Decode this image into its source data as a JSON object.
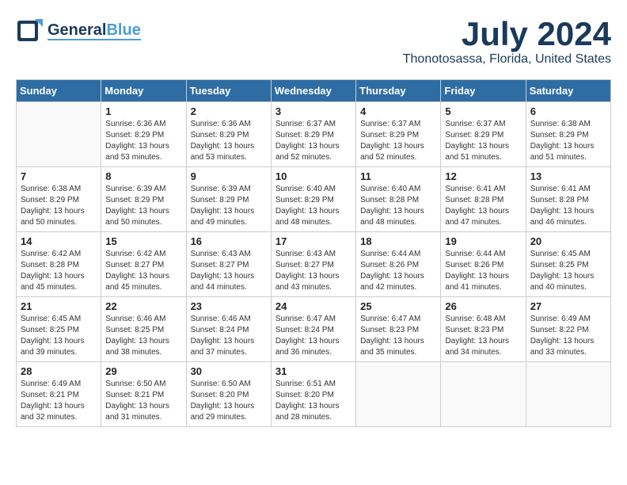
{
  "header": {
    "logo_general": "General",
    "logo_blue": "Blue",
    "month_year": "July 2024",
    "location": "Thonotosassa, Florida, United States"
  },
  "calendar": {
    "days_of_week": [
      "Sunday",
      "Monday",
      "Tuesday",
      "Wednesday",
      "Thursday",
      "Friday",
      "Saturday"
    ],
    "weeks": [
      [
        {
          "day": "",
          "info": ""
        },
        {
          "day": "1",
          "info": "Sunrise: 6:36 AM\nSunset: 8:29 PM\nDaylight: 13 hours\nand 53 minutes."
        },
        {
          "day": "2",
          "info": "Sunrise: 6:36 AM\nSunset: 8:29 PM\nDaylight: 13 hours\nand 53 minutes."
        },
        {
          "day": "3",
          "info": "Sunrise: 6:37 AM\nSunset: 8:29 PM\nDaylight: 13 hours\nand 52 minutes."
        },
        {
          "day": "4",
          "info": "Sunrise: 6:37 AM\nSunset: 8:29 PM\nDaylight: 13 hours\nand 52 minutes."
        },
        {
          "day": "5",
          "info": "Sunrise: 6:37 AM\nSunset: 8:29 PM\nDaylight: 13 hours\nand 51 minutes."
        },
        {
          "day": "6",
          "info": "Sunrise: 6:38 AM\nSunset: 8:29 PM\nDaylight: 13 hours\nand 51 minutes."
        }
      ],
      [
        {
          "day": "7",
          "info": "Sunrise: 6:38 AM\nSunset: 8:29 PM\nDaylight: 13 hours\nand 50 minutes."
        },
        {
          "day": "8",
          "info": "Sunrise: 6:39 AM\nSunset: 8:29 PM\nDaylight: 13 hours\nand 50 minutes."
        },
        {
          "day": "9",
          "info": "Sunrise: 6:39 AM\nSunset: 8:29 PM\nDaylight: 13 hours\nand 49 minutes."
        },
        {
          "day": "10",
          "info": "Sunrise: 6:40 AM\nSunset: 8:29 PM\nDaylight: 13 hours\nand 48 minutes."
        },
        {
          "day": "11",
          "info": "Sunrise: 6:40 AM\nSunset: 8:28 PM\nDaylight: 13 hours\nand 48 minutes."
        },
        {
          "day": "12",
          "info": "Sunrise: 6:41 AM\nSunset: 8:28 PM\nDaylight: 13 hours\nand 47 minutes."
        },
        {
          "day": "13",
          "info": "Sunrise: 6:41 AM\nSunset: 8:28 PM\nDaylight: 13 hours\nand 46 minutes."
        }
      ],
      [
        {
          "day": "14",
          "info": "Sunrise: 6:42 AM\nSunset: 8:28 PM\nDaylight: 13 hours\nand 45 minutes."
        },
        {
          "day": "15",
          "info": "Sunrise: 6:42 AM\nSunset: 8:27 PM\nDaylight: 13 hours\nand 45 minutes."
        },
        {
          "day": "16",
          "info": "Sunrise: 6:43 AM\nSunset: 8:27 PM\nDaylight: 13 hours\nand 44 minutes."
        },
        {
          "day": "17",
          "info": "Sunrise: 6:43 AM\nSunset: 8:27 PM\nDaylight: 13 hours\nand 43 minutes."
        },
        {
          "day": "18",
          "info": "Sunrise: 6:44 AM\nSunset: 8:26 PM\nDaylight: 13 hours\nand 42 minutes."
        },
        {
          "day": "19",
          "info": "Sunrise: 6:44 AM\nSunset: 8:26 PM\nDaylight: 13 hours\nand 41 minutes."
        },
        {
          "day": "20",
          "info": "Sunrise: 6:45 AM\nSunset: 8:25 PM\nDaylight: 13 hours\nand 40 minutes."
        }
      ],
      [
        {
          "day": "21",
          "info": "Sunrise: 6:45 AM\nSunset: 8:25 PM\nDaylight: 13 hours\nand 39 minutes."
        },
        {
          "day": "22",
          "info": "Sunrise: 6:46 AM\nSunset: 8:25 PM\nDaylight: 13 hours\nand 38 minutes."
        },
        {
          "day": "23",
          "info": "Sunrise: 6:46 AM\nSunset: 8:24 PM\nDaylight: 13 hours\nand 37 minutes."
        },
        {
          "day": "24",
          "info": "Sunrise: 6:47 AM\nSunset: 8:24 PM\nDaylight: 13 hours\nand 36 minutes."
        },
        {
          "day": "25",
          "info": "Sunrise: 6:47 AM\nSunset: 8:23 PM\nDaylight: 13 hours\nand 35 minutes."
        },
        {
          "day": "26",
          "info": "Sunrise: 6:48 AM\nSunset: 8:23 PM\nDaylight: 13 hours\nand 34 minutes."
        },
        {
          "day": "27",
          "info": "Sunrise: 6:49 AM\nSunset: 8:22 PM\nDaylight: 13 hours\nand 33 minutes."
        }
      ],
      [
        {
          "day": "28",
          "info": "Sunrise: 6:49 AM\nSunset: 8:21 PM\nDaylight: 13 hours\nand 32 minutes."
        },
        {
          "day": "29",
          "info": "Sunrise: 6:50 AM\nSunset: 8:21 PM\nDaylight: 13 hours\nand 31 minutes."
        },
        {
          "day": "30",
          "info": "Sunrise: 6:50 AM\nSunset: 8:20 PM\nDaylight: 13 hours\nand 29 minutes."
        },
        {
          "day": "31",
          "info": "Sunrise: 6:51 AM\nSunset: 8:20 PM\nDaylight: 13 hours\nand 28 minutes."
        },
        {
          "day": "",
          "info": ""
        },
        {
          "day": "",
          "info": ""
        },
        {
          "day": "",
          "info": ""
        }
      ]
    ]
  }
}
